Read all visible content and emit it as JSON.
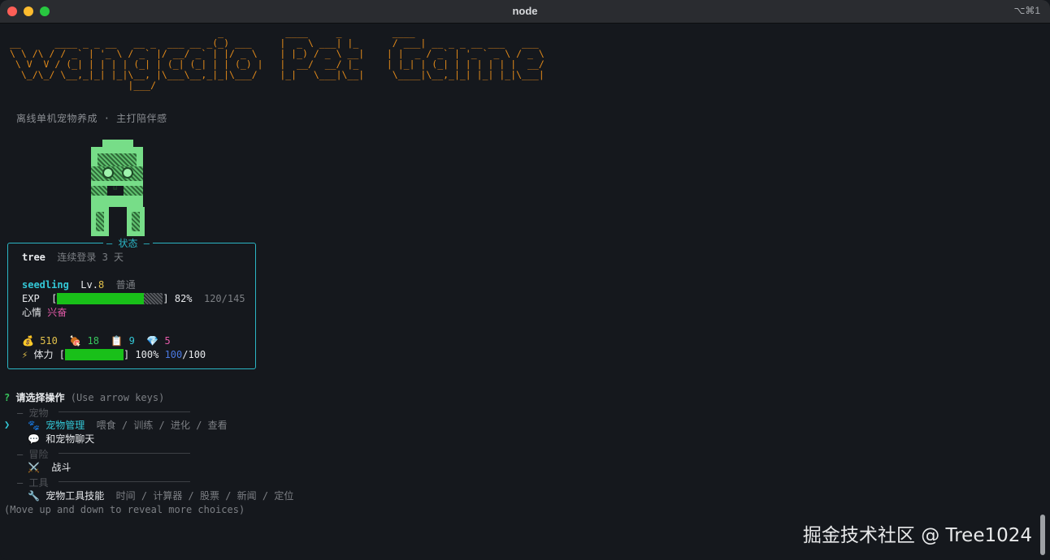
{
  "window": {
    "title": "node",
    "shortcut": "⌥⌘1"
  },
  "banner": {
    "ascii_art": "                                     _           ____     _         ____\n__      ____ _ _ __   __ _  ___ __ _(_) ___     |  _ \\ ___| |_      / ___| __ _ _ __ ___   ___\n\\ \\ /\\ / / _` | '_ \\ / _` |/ __/ _` | |/ _ \\    | |_) / _ \\ __|    | |  _ / _` | '_ ` _ \\ / _ \\\n \\ V  V / (_| | | | | (_| | (_| (_| | | (_) |   |  __/  __/ |_     | |_| | (_| | | | | | |  __/\n  \\_/\\_/ \\__,_|_| |_|\\__, |\\___\\__,_|_|\\___/    |_|   \\___|\\__|     \\____|\\__,_|_| |_| |_|\\___|\n                     |___/",
    "subtitle": "离线单机宠物养成 · 主打陪伴感"
  },
  "status": {
    "title": "状态",
    "username": "tree",
    "login_streak": "连续登录 3 天",
    "pet_name": "seedling",
    "level_label": "Lv.",
    "level": "8",
    "rarity": "普通",
    "exp_label": "EXP",
    "exp_percent_text": "82%",
    "exp_progress": 0.82,
    "exp_value": "120/145",
    "mood_label": "心情",
    "mood": "兴奋",
    "coins": "510",
    "food": "18",
    "tasks": "9",
    "gems": "5",
    "energy_label": "体力",
    "energy_percent_text": "100%",
    "energy_progress": 1.0,
    "energy_current": "100",
    "energy_max": "/100",
    "icons": {
      "coins": "money-bag-icon",
      "food": "meat-icon",
      "tasks": "clipboard-icon",
      "gems": "gem-icon",
      "energy": "lightning-icon"
    }
  },
  "prompt": {
    "mark": "?",
    "question": "请选择操作",
    "hint": "(Use arrow keys)",
    "footer": "(Move up and down to reveal more choices)"
  },
  "menu": {
    "cursor": "❯",
    "sections": {
      "pet": "宠物",
      "adventure": "冒险",
      "tools": "工具"
    },
    "items": [
      {
        "label": "宠物管理",
        "desc": "喂食 / 训练 / 进化 / 查看",
        "icon": "paw-icon"
      },
      {
        "label": "和宠物聊天",
        "desc": "",
        "icon": "speech-bubble-icon"
      },
      {
        "label": "战斗",
        "desc": "",
        "icon": "crossed-swords-icon"
      },
      {
        "label": "宠物工具技能",
        "desc": "时间 / 计算器 / 股票 / 新闻 / 定位",
        "icon": "wrench-icon"
      }
    ]
  },
  "watermark": "掘金技术社区 @ Tree1024",
  "colors": {
    "background": "#15181d",
    "accent_cyan": "#33c7d6",
    "banner_orange": "#e28a1a",
    "pet_green": "#77dd88",
    "bar_green": "#19c019"
  }
}
